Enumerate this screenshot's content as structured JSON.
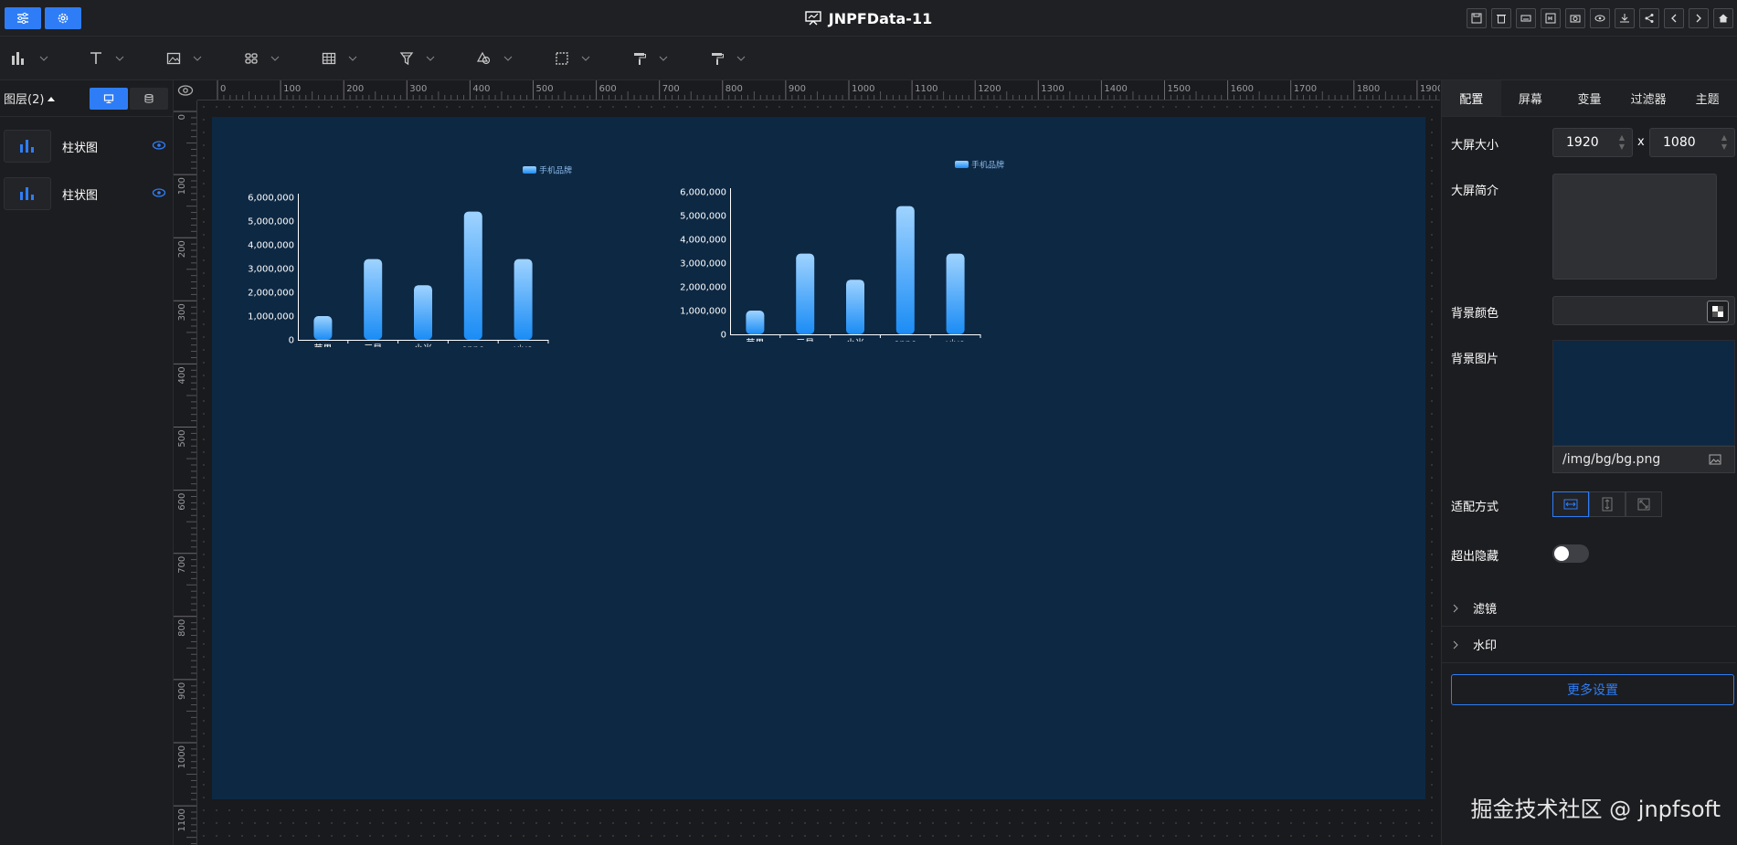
{
  "app": {
    "title": "JNPFData-11"
  },
  "left_panel": {
    "layers_label": "图层(2)",
    "layers": [
      {
        "name": "柱状图"
      },
      {
        "name": "柱状图"
      }
    ]
  },
  "ruler": {
    "h_ticks": [
      "0",
      "100",
      "200",
      "300",
      "400",
      "500",
      "600",
      "700",
      "800",
      "900",
      "1000",
      "1100",
      "1200",
      "1300",
      "1400",
      "1500",
      "1600",
      "1700",
      "1800",
      "1900"
    ],
    "v_ticks": [
      "0",
      "100",
      "200",
      "300",
      "400",
      "500",
      "600",
      "700",
      "800",
      "900",
      "1000",
      "1100"
    ]
  },
  "right_panel": {
    "tabs": [
      "配置",
      "屏幕",
      "变量",
      "过滤器",
      "主题"
    ],
    "active_tab": "配置",
    "screen_size_label": "大屏大小",
    "width_value": "1920",
    "x_label": "x",
    "height_value": "1080",
    "intro_label": "大屏简介",
    "bg_color_label": "背景颜色",
    "bg_image_label": "背景图片",
    "bg_image_path": "/img/bg/bg.png",
    "fit_label": "适配方式",
    "overflow_label": "超出隐藏",
    "filter_label": "滤镜",
    "watermark_label": "水印",
    "more_settings": "更多设置"
  },
  "watermark_text": "掘金技术社区 @ jnpfsoft",
  "chart_data": [
    {
      "type": "bar",
      "categories": [
        "苹果",
        "三星",
        "小米",
        "oppo",
        "vivo"
      ],
      "series": [
        {
          "name": "手机品牌",
          "values": [
            1000000,
            3400000,
            2300000,
            5400000,
            3400000
          ]
        }
      ],
      "ytick_labels": [
        "0",
        "1,000,000",
        "2,000,000",
        "3,000,000",
        "4,000,000",
        "5,000,000",
        "6,000,000"
      ],
      "ylim": [
        0,
        6000000
      ],
      "legend": "top-right",
      "colors": {
        "bar_top": "#9fd3ff",
        "bar_bottom": "#1a8cf5",
        "axis": "#ffffff"
      }
    },
    {
      "type": "bar",
      "categories": [
        "苹果",
        "三星",
        "小米",
        "oppo",
        "vivo"
      ],
      "series": [
        {
          "name": "手机品牌",
          "values": [
            1000000,
            3400000,
            2300000,
            5400000,
            3400000
          ]
        }
      ],
      "ytick_labels": [
        "0",
        "1,000,000",
        "2,000,000",
        "3,000,000",
        "4,000,000",
        "5,000,000",
        "6,000,000"
      ],
      "ylim": [
        0,
        6000000
      ],
      "legend": "top-right",
      "colors": {
        "bar_top": "#9fd3ff",
        "bar_bottom": "#1a8cf5",
        "axis": "#ffffff"
      }
    }
  ]
}
